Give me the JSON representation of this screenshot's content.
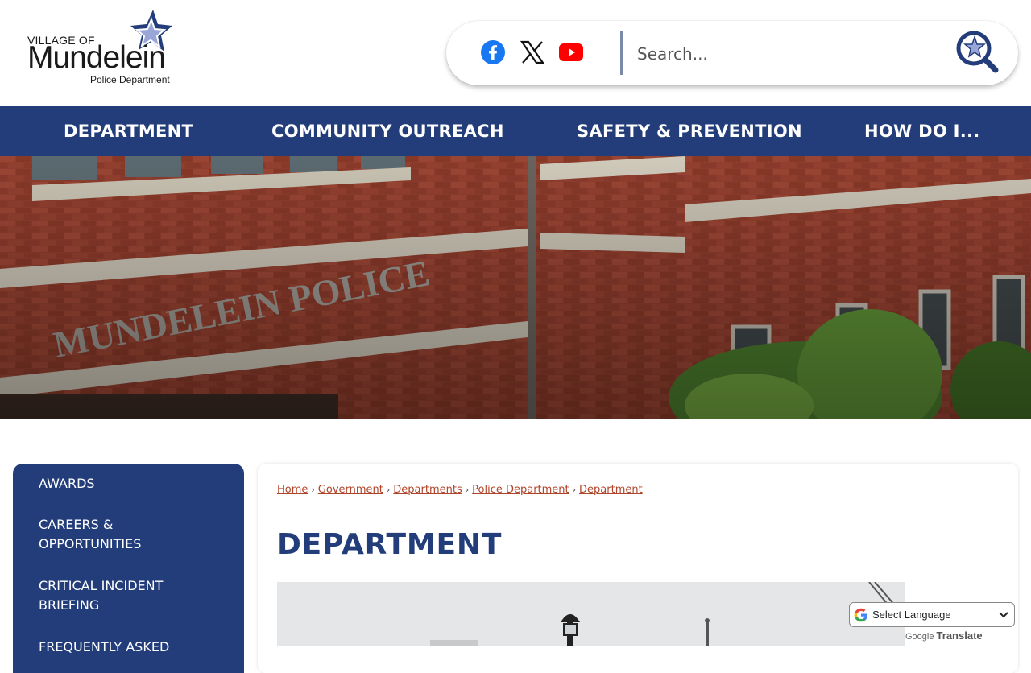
{
  "logo": {
    "village": "VILLAGE OF",
    "name": "Mundelein",
    "sub": "Police Department"
  },
  "social": {
    "facebook_icon": "facebook-icon",
    "x_icon": "x-twitter-icon",
    "youtube_icon": "youtube-icon"
  },
  "search": {
    "placeholder": "Search..."
  },
  "nav": {
    "items": [
      {
        "label": "DEPARTMENT"
      },
      {
        "label": "COMMUNITY OUTREACH"
      },
      {
        "label": "SAFETY & PREVENTION"
      },
      {
        "label": "HOW DO I..."
      }
    ]
  },
  "banner": {
    "building_text": "MUNDELEIN POLICE"
  },
  "sidebar": {
    "items": [
      {
        "label": "AWARDS"
      },
      {
        "label": "CAREERS & OPPORTUNITIES"
      },
      {
        "label": "CRITICAL INCIDENT BRIEFING"
      },
      {
        "label": "FREQUENTLY ASKED"
      }
    ]
  },
  "breadcrumb": {
    "items": [
      "Home",
      "Government",
      "Departments",
      "Police Department",
      "Department"
    ],
    "separator": "›"
  },
  "page": {
    "title": "DEPARTMENT"
  },
  "translate": {
    "select_label": "Select Language",
    "powered_by": "Google",
    "translate_word": "Translate"
  },
  "colors": {
    "brand_navy": "#233d7b",
    "link_red": "#b0442a",
    "facebook_blue": "#1877f2",
    "youtube_red": "#ff0000"
  }
}
